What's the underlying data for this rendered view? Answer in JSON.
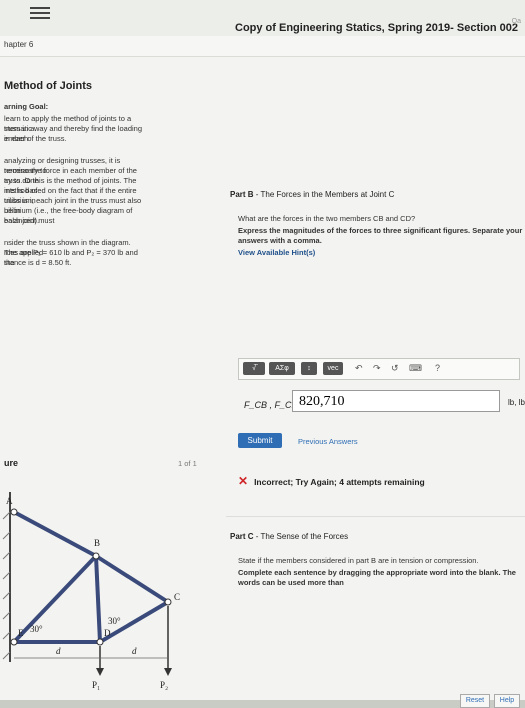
{
  "header": {
    "title": "Copy of Engineering Statics, Spring 2019- Section 002",
    "chapter": "hapter 6",
    "qa": "Qa"
  },
  "left": {
    "section_title": "Method of Joints",
    "goal_label": "arning Goal:",
    "goal_lines": [
      "learn to apply the method of joints to a truss in a",
      "stematic way and thereby find the loading in each",
      "ember of the truss."
    ],
    "analysis_lines": [
      "analyzing or designing trusses, it is necessary to",
      "termine the force in each member of the truss. One",
      "ay to do this is the method of joints. The method of",
      "ints is based on the fact that if the entire truss is in",
      "uilibrium, each joint in the truss must also be in",
      "uilibrium (i.e., the free-body diagram of each joint must",
      " balanced)."
    ],
    "problem_lines": [
      "nsider the truss shown in the diagram. The applied",
      "rces are P₁ = 610 lb and P₂ = 370 lb and the",
      "stance is d = 8.50 ft."
    ],
    "figure_label": "ure",
    "pager": "1 of 1"
  },
  "diagram": {
    "labels": [
      "A",
      "B",
      "C",
      "D",
      "E",
      "30°",
      "30°",
      "d",
      "d",
      "P₁",
      "P₂"
    ]
  },
  "partB": {
    "header_prefix": "Part B",
    "header_text": " - The Forces in the Members at Joint C",
    "question": "What are the forces in the two members CB and CD?",
    "instruction": "Express the magnitudes of the forces to three significant figures. Separate your answers with a comma.",
    "hint": "View Available Hint(s)",
    "toolbar": {
      "templates": "√̅",
      "alpha": "AΣφ",
      "arrows": "↕",
      "vec": "vec",
      "undo": "↶",
      "redo": "↷",
      "reset": "↺",
      "keyboard": "⌨",
      "help": "?"
    },
    "answer_label": "F_CB , F_CD =",
    "answer_value": "820,710",
    "units": "lb, lb",
    "submit": "Submit",
    "previous": "Previous Answers",
    "feedback": "Incorrect; Try Again; 4 attempts remaining"
  },
  "partC": {
    "header_prefix": "Part C",
    "header_text": " - The Sense of the Forces",
    "line1": "State if the members considered in part B are in tension or compression.",
    "line2": "Complete each sentence by dragging the appropriate word into the blank. The words can be used more than",
    "reset": "Reset",
    "help": "Help"
  }
}
